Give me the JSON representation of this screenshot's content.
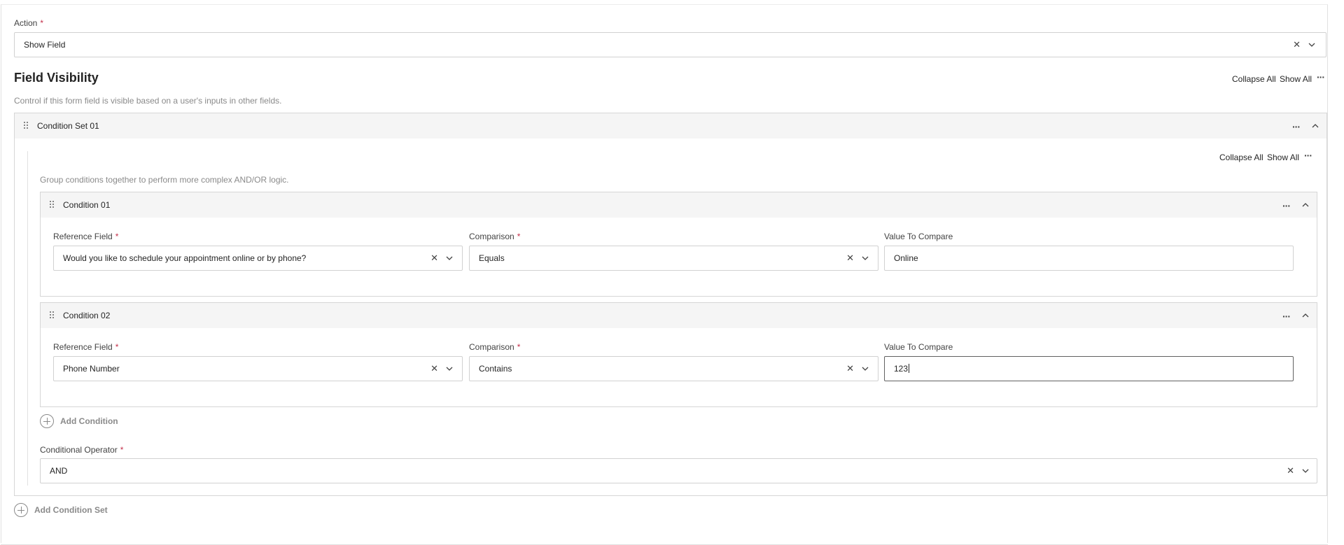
{
  "action": {
    "label": "Action",
    "required_mark": "*",
    "value": "Show Field"
  },
  "visibility": {
    "title": "Field Visibility",
    "description": "Control if this form field is visible based on a user's inputs in other fields.",
    "collapse_all": "Collapse All",
    "show_all": "Show All"
  },
  "condition_set": {
    "title": "Condition Set 01",
    "collapse_all": "Collapse All",
    "show_all": "Show All",
    "description": "Group conditions together to perform more complex AND/OR logic.",
    "conditions": [
      {
        "title": "Condition 01",
        "reference_label": "Reference Field",
        "reference_value": "Would you like to schedule your appointment online or by phone?",
        "comparison_label": "Comparison",
        "comparison_value": "Equals",
        "compare_label": "Value To Compare",
        "compare_value": "Online"
      },
      {
        "title": "Condition 02",
        "reference_label": "Reference Field",
        "reference_value": "Phone Number",
        "comparison_label": "Comparison",
        "comparison_value": "Contains",
        "compare_label": "Value To Compare",
        "compare_value": "123"
      }
    ],
    "add_condition": "Add Condition",
    "operator_label": "Conditional Operator",
    "operator_value": "AND"
  },
  "add_condition_set": "Add Condition Set",
  "icons": {
    "clear": "close-icon",
    "dropdown": "chevron-down-icon",
    "collapse": "chevron-up-icon",
    "more": "more-horizontal-icon",
    "drag": "drag-handle-icon",
    "add": "add-circle-icon"
  },
  "colors": {
    "required": "#c4314b",
    "header_bg": "#f5f5f5",
    "hint": "#8a8a8a"
  }
}
